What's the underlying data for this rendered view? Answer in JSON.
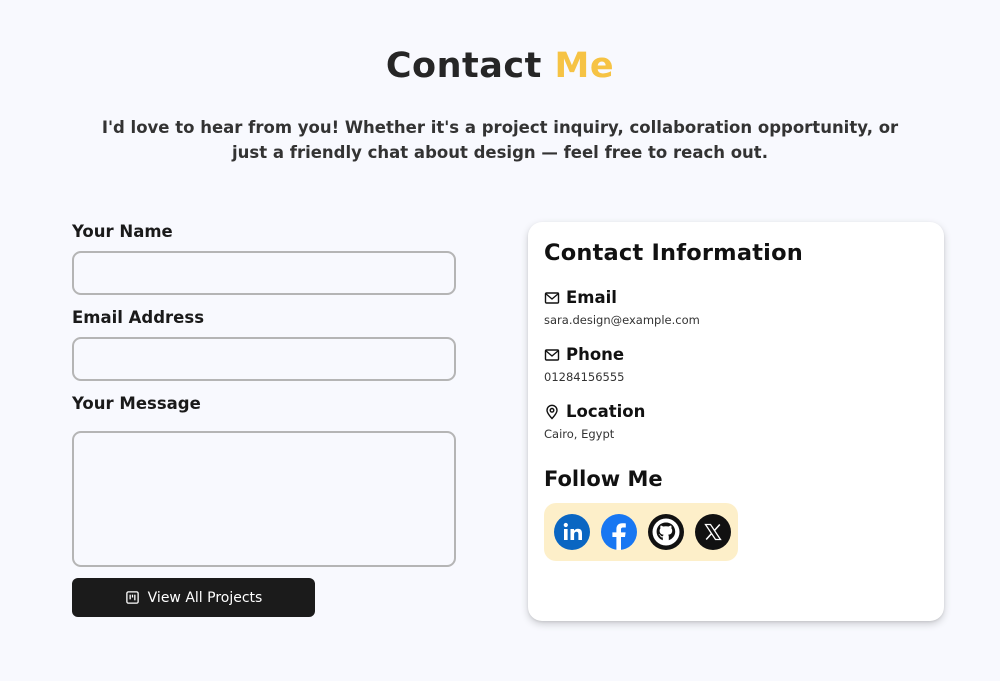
{
  "header": {
    "title_main": "Contact",
    "title_accent": "Me",
    "subtitle": "I'd love to hear from you! Whether it's a project inquiry, collaboration opportunity, or just a friendly chat about design — feel free to reach out."
  },
  "form": {
    "name_label": "Your Name",
    "name_value": "",
    "email_label": "Email Address",
    "email_value": "",
    "message_label": "Your Message",
    "message_value": "",
    "button_label": "View All Projects",
    "button_icon": "kanban-icon"
  },
  "contact_info": {
    "title": "Contact Information",
    "items": [
      {
        "label": "Email",
        "value": "sara.design@example.com",
        "icon": "mail-icon"
      },
      {
        "label": "Phone",
        "value": "01284156555",
        "icon": "mail-icon"
      },
      {
        "label": "Location",
        "value": "Cairo, Egypt",
        "icon": "map-pin-icon"
      }
    ],
    "follow_title": "Follow Me",
    "socials": [
      "linkedin-icon",
      "facebook-icon",
      "github-icon",
      "x-icon"
    ]
  },
  "colors": {
    "accent": "#f6c344",
    "background": "#f8f9fe",
    "button": "#1b1b1b",
    "social_bg": "#fdefc9",
    "linkedin": "#0a66c2",
    "facebook": "#1877f2"
  }
}
